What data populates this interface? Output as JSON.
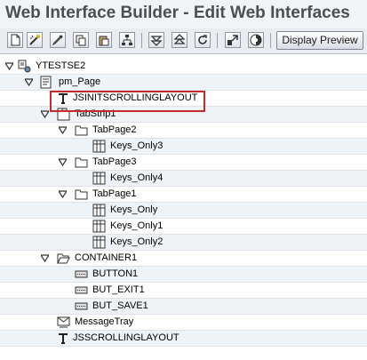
{
  "title": "Web Interface Builder - Edit Web Interfaces",
  "toolbar": {
    "display_preview_label": "Display Preview"
  },
  "tree": [
    {
      "label": "YTESTSE2",
      "icon": "interface-icon",
      "expanded": true
    },
    {
      "label": "pm_Page",
      "icon": "page-icon",
      "expanded": true
    },
    {
      "label": "JSINITSCROLLINGLAYOUT",
      "icon": "text-item-icon",
      "selected": true
    },
    {
      "label": "TabStrip1",
      "icon": "tabstrip-icon",
      "expanded": true
    },
    {
      "label": "TabPage2",
      "icon": "folder-icon",
      "expanded": true
    },
    {
      "label": "Keys_Only3",
      "icon": "table-icon"
    },
    {
      "label": "TabPage3",
      "icon": "folder-icon",
      "expanded": true
    },
    {
      "label": "Keys_Only4",
      "icon": "table-icon"
    },
    {
      "label": "TabPage1",
      "icon": "folder-icon",
      "expanded": true
    },
    {
      "label": "Keys_Only",
      "icon": "table-icon"
    },
    {
      "label": "Keys_Only1",
      "icon": "table-icon"
    },
    {
      "label": "Keys_Only2",
      "icon": "table-icon"
    },
    {
      "label": "CONTAINER1",
      "icon": "open-folder-icon",
      "expanded": true
    },
    {
      "label": "BUTTON1",
      "icon": "button-item-icon"
    },
    {
      "label": "BUT_EXIT1",
      "icon": "button-item-icon"
    },
    {
      "label": "BUT_SAVE1",
      "icon": "button-item-icon"
    },
    {
      "label": "MessageTray",
      "icon": "message-tray-icon"
    },
    {
      "label": "JSSCROLLINGLAYOUT",
      "icon": "text-item-icon"
    }
  ]
}
